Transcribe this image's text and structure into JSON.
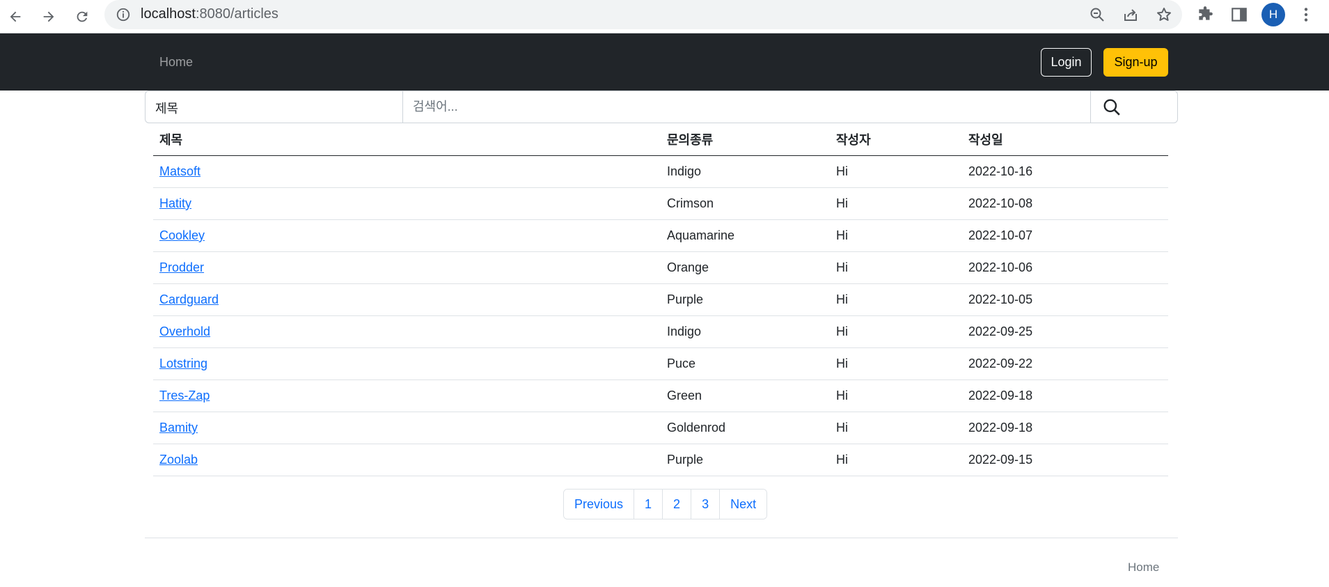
{
  "browser": {
    "url_host": "localhost",
    "url_path": ":8080/articles",
    "profile_initial": "H"
  },
  "navbar": {
    "home_label": "Home",
    "login_label": "Login",
    "signup_label": "Sign-up",
    "signup_color": "#ffc107",
    "bg_color": "#212529"
  },
  "search": {
    "field_selected": "제목",
    "placeholder": "검색어..."
  },
  "table": {
    "headers": [
      "제목",
      "문의종류",
      "작성자",
      "작성일"
    ],
    "rows": [
      {
        "title": "Matsoft",
        "type": "Indigo",
        "author": "Hi",
        "date": "2022-10-16"
      },
      {
        "title": "Hatity",
        "type": "Crimson",
        "author": "Hi",
        "date": "2022-10-08"
      },
      {
        "title": "Cookley",
        "type": "Aquamarine",
        "author": "Hi",
        "date": "2022-10-07"
      },
      {
        "title": "Prodder",
        "type": "Orange",
        "author": "Hi",
        "date": "2022-10-06"
      },
      {
        "title": "Cardguard",
        "type": "Purple",
        "author": "Hi",
        "date": "2022-10-05"
      },
      {
        "title": "Overhold",
        "type": "Indigo",
        "author": "Hi",
        "date": "2022-09-25"
      },
      {
        "title": "Lotstring",
        "type": "Puce",
        "author": "Hi",
        "date": "2022-09-22"
      },
      {
        "title": "Tres-Zap",
        "type": "Green",
        "author": "Hi",
        "date": "2022-09-18"
      },
      {
        "title": "Bamity",
        "type": "Goldenrod",
        "author": "Hi",
        "date": "2022-09-18"
      },
      {
        "title": "Zoolab",
        "type": "Purple",
        "author": "Hi",
        "date": "2022-09-15"
      }
    ]
  },
  "pagination": {
    "previous_label": "Previous",
    "pages": [
      "1",
      "2",
      "3"
    ],
    "next_label": "Next"
  },
  "footer": {
    "home_label": "Home"
  },
  "colors": {
    "link": "#0d6efd",
    "profile": "#1a5fb4"
  }
}
